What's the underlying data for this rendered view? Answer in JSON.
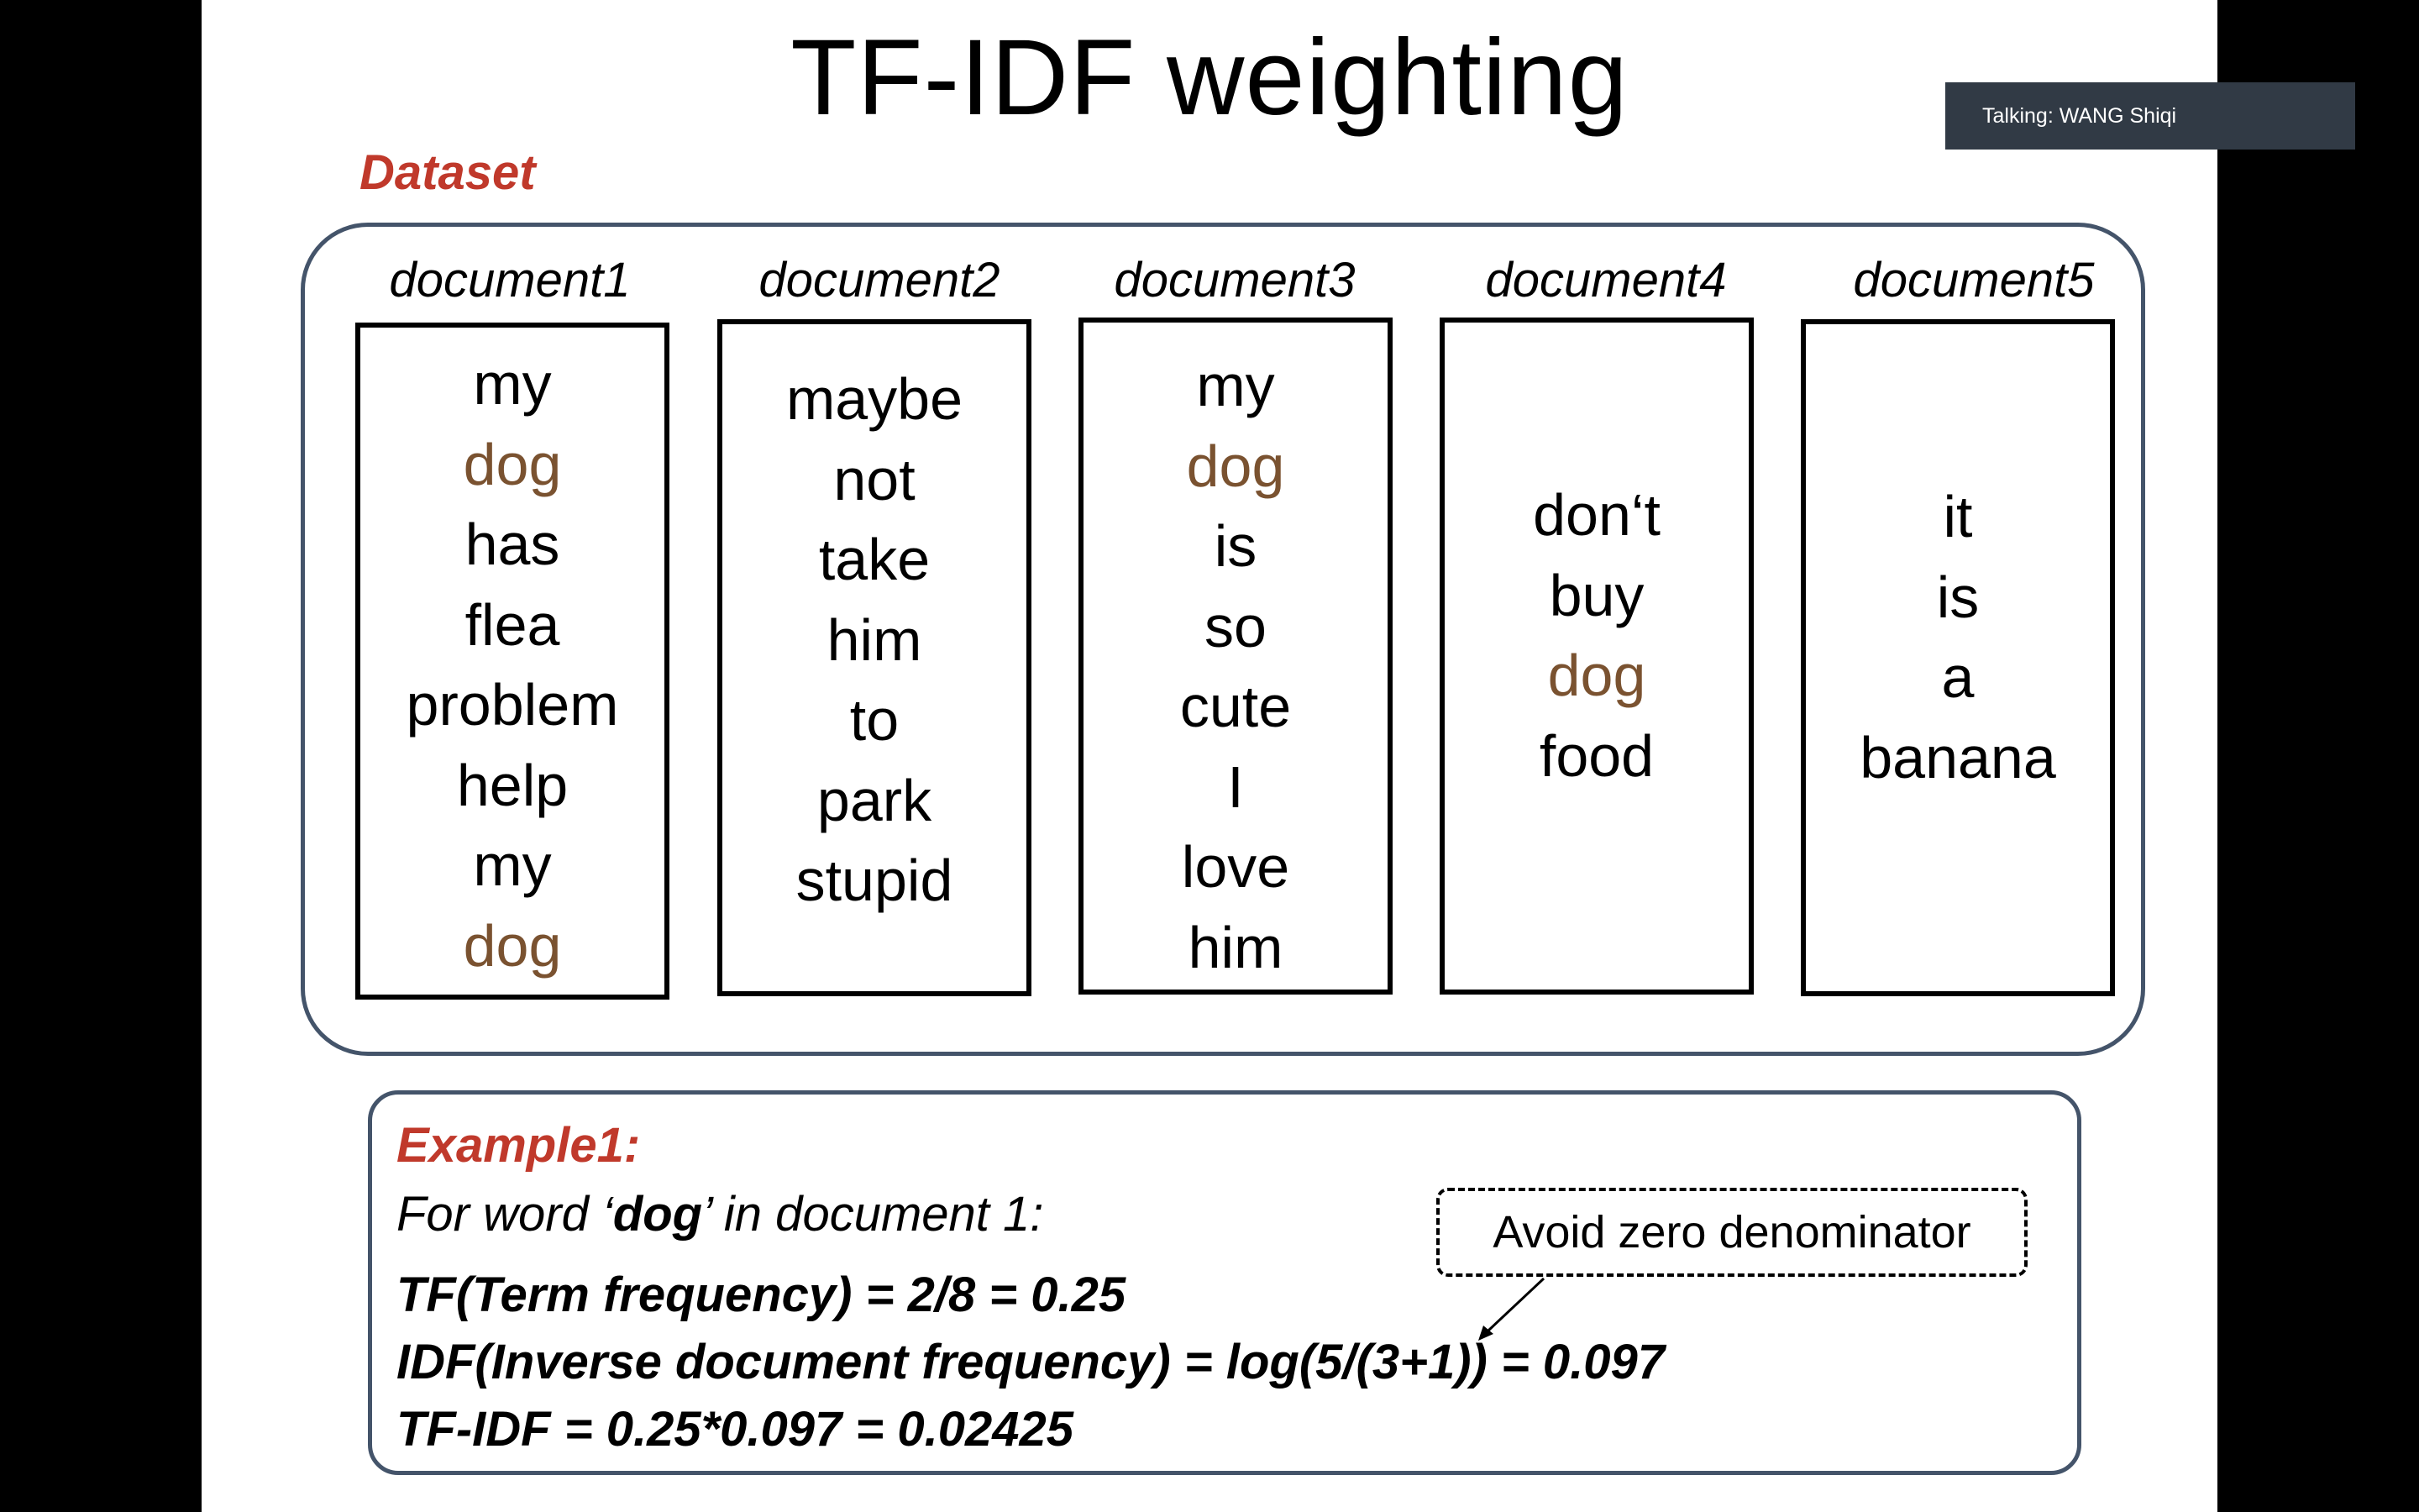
{
  "slide": {
    "title": "TF-IDF weighting",
    "dataset_label": "Dataset",
    "documents": [
      {
        "title": "document1",
        "words": [
          "my",
          "dog",
          "has",
          "flea",
          "problem",
          "help",
          "my",
          "dog"
        ]
      },
      {
        "title": "document2",
        "words": [
          "maybe",
          "not",
          "take",
          "him",
          "to",
          "park",
          "stupid"
        ]
      },
      {
        "title": "document3",
        "words": [
          "my",
          "dog",
          "is",
          "so",
          "cute",
          "I",
          "love",
          "him"
        ]
      },
      {
        "title": "document4",
        "words": [
          "don‘t",
          "buy",
          "dog",
          "food"
        ]
      },
      {
        "title": "document5",
        "words": [
          "it",
          "is",
          "a",
          "banana"
        ]
      }
    ],
    "highlight_word": "dog",
    "example": {
      "title": "Example1:",
      "line1_pre": "For word ‘",
      "line1_word": "dog",
      "line1_post": "’ in document 1:",
      "tf_line": "TF(Term frequency) = 2/8 = 0.25",
      "idf_line": "IDF(Inverse document frequency) = log(5/(3+1)) = 0.097",
      "tfidf_line": "TF-IDF = 0.25*0.097 = 0.02425",
      "callout": "Avoid zero denominator"
    }
  },
  "notification": {
    "text": "Talking: WANG Shiqi"
  },
  "colors": {
    "accent_red": "#c0392b",
    "highlight_brown": "#7a5230",
    "box_border": "#44546a",
    "toast_bg": "#313a45"
  }
}
